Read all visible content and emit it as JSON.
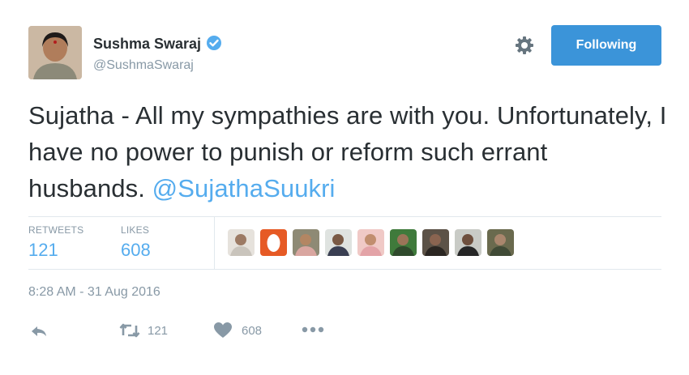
{
  "profile": {
    "name": "Sushma Swaraj",
    "handle": "@SushmaSwaraj",
    "verified": true
  },
  "follow_button": {
    "label": "Following",
    "color": "#3b94d9"
  },
  "tweet": {
    "text": "Sujatha - All my sympathies are with you. Unfortunately, I have no power to punish or reform such errant husbands. ",
    "mention": "@SujathaSuukri",
    "mention_color": "#55acee"
  },
  "stats": {
    "retweets_label": "RETWEETS",
    "retweets_value": "121",
    "likes_label": "LIKES",
    "likes_value": "608"
  },
  "likers": [
    {
      "icon": "avatar-person"
    },
    {
      "icon": "avatar-orange-egg"
    },
    {
      "icon": "avatar-person"
    },
    {
      "icon": "avatar-person"
    },
    {
      "icon": "avatar-person"
    },
    {
      "icon": "avatar-person"
    },
    {
      "icon": "avatar-person"
    },
    {
      "icon": "avatar-person"
    },
    {
      "icon": "avatar-person"
    }
  ],
  "timestamp": "8:28 AM - 31 Aug 2016",
  "actions": {
    "reply_icon": "reply-icon",
    "retweet_icon": "retweet-icon",
    "retweet_count": "121",
    "like_icon": "heart-icon",
    "like_count": "608",
    "more_icon": "more-icon"
  }
}
